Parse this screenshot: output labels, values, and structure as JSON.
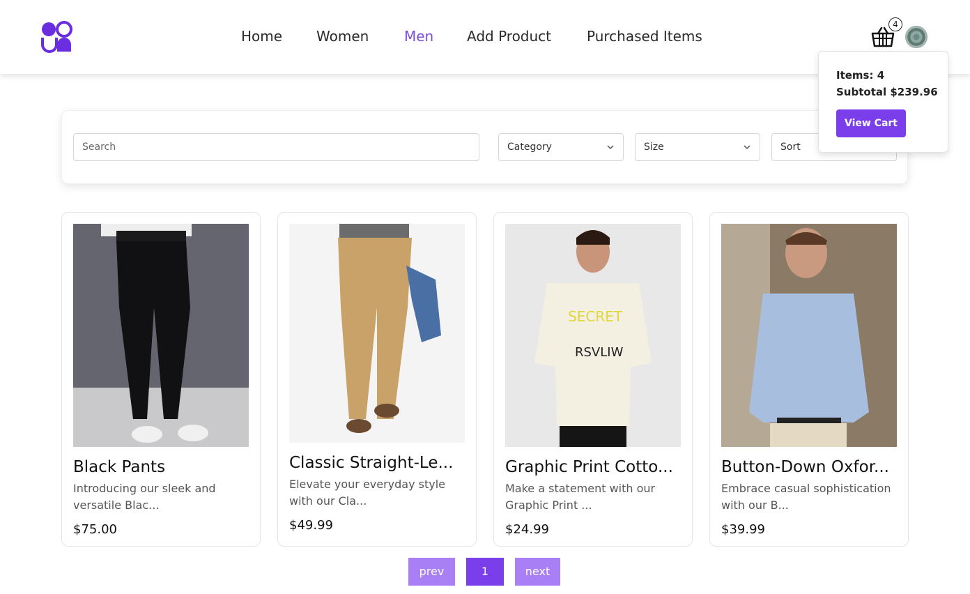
{
  "header": {
    "nav": [
      {
        "label": "Home",
        "active": false
      },
      {
        "label": "Women",
        "active": false
      },
      {
        "label": "Men",
        "active": true
      },
      {
        "label": "Add Product",
        "active": false
      },
      {
        "label": "Purchased Items",
        "active": false
      }
    ],
    "cart_count": "4",
    "accent_color": "#7c4ddb"
  },
  "cart_dropdown": {
    "items": "Items: 4",
    "subtotal": "Subtotal $239.96",
    "view_cart": "View Cart"
  },
  "filters": {
    "search_placeholder": "Search",
    "category": "Category",
    "size": "Size",
    "sort": "Sort"
  },
  "products": [
    {
      "title": "Black Pants",
      "desc_line1": "Introducing our sleek and",
      "desc_line2": "versatile Blac...",
      "price": "$75.00",
      "image": "man-in-black-pants-photo"
    },
    {
      "title": "Classic Straight-Le...",
      "desc_line1": "Elevate your everyday style",
      "desc_line2": "with our Cla...",
      "price": "$49.99",
      "image": "man-in-khaki-pants-photo"
    },
    {
      "title": "Graphic Print Cotto...",
      "desc_line1": "Make a statement with our",
      "desc_line2": "Graphic Print ...",
      "price": "$24.99",
      "image": "man-in-graphic-tshirt-photo"
    },
    {
      "title": "Button-Down Oxfor...",
      "desc_line1": "Embrace casual sophistication",
      "desc_line2": "with our B...",
      "price": "$39.99",
      "image": "man-in-oxford-shirt-photo"
    }
  ],
  "pagination": {
    "prev": "prev",
    "page": "1",
    "next": "next"
  }
}
